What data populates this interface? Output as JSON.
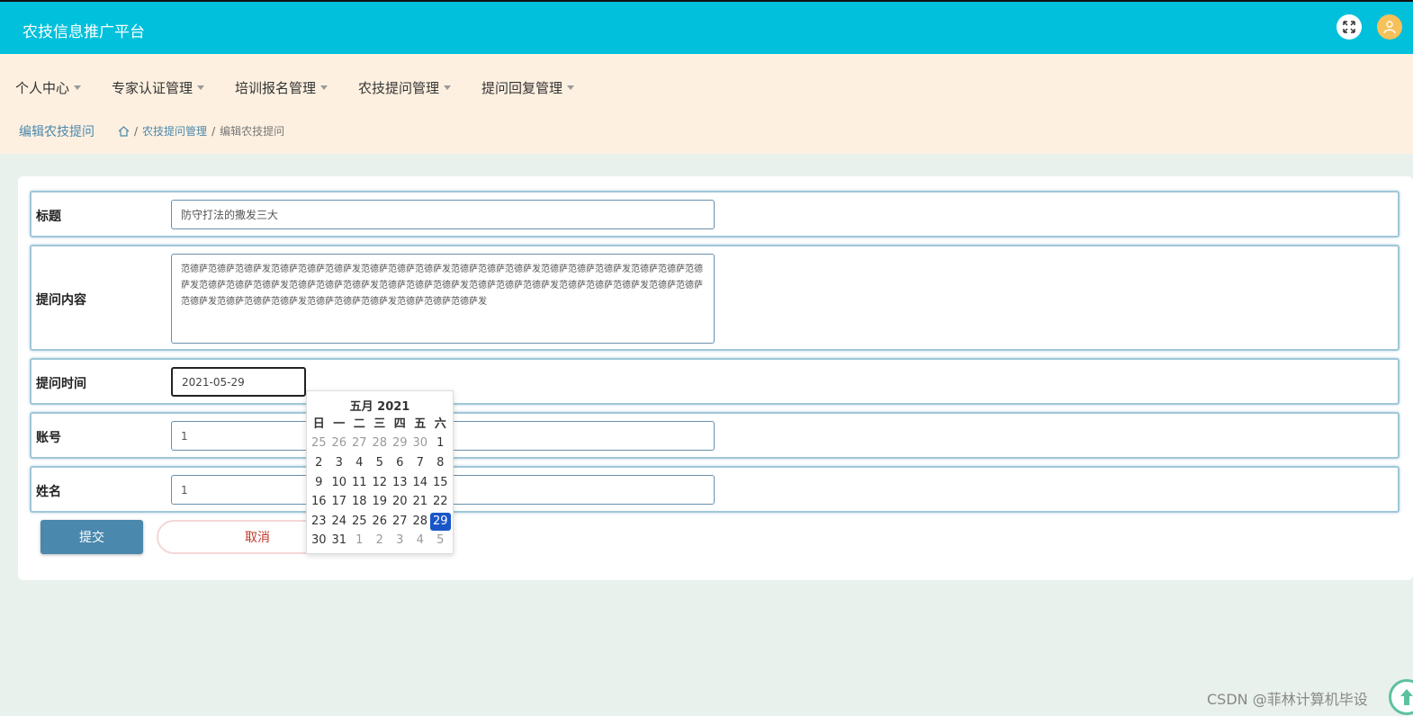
{
  "header": {
    "title": "农技信息推广平台",
    "fullscreen_icon": "fullscreen-icon",
    "avatar_icon": "user-avatar-icon"
  },
  "menu": {
    "items": [
      {
        "label": "个人中心"
      },
      {
        "label": "专家认证管理"
      },
      {
        "label": "培训报名管理"
      },
      {
        "label": "农技提问管理"
      },
      {
        "label": "提问回复管理"
      }
    ]
  },
  "breadcrumb": {
    "page_title": "编辑农技提问",
    "home_icon": "home-icon",
    "sep": "/",
    "parent": "农技提问管理",
    "current": "编辑农技提问"
  },
  "form": {
    "title_label": "标题",
    "title_value": "防守打法的撒发三大",
    "content_label": "提问内容",
    "content_value": "范德萨范德萨范德萨发范德萨范德萨范德萨发范德萨范德萨范德萨发范德萨范德萨范德萨发范德萨范德萨范德萨发范德萨范德萨范德萨发范德萨范德萨范德萨发范德萨范德萨范德萨发范德萨范德萨范德萨发范德萨范德萨范德萨发范德萨范德萨范德萨发范德萨范德萨范德萨发范德萨范德萨范德萨发范德萨范德萨范德萨发范德萨范德萨范德萨发",
    "time_label": "提问时间",
    "time_value": "2021-05-29",
    "account_label": "账号",
    "account_value": "1",
    "name_label": "姓名",
    "name_value": "1",
    "submit_label": "提交",
    "cancel_label": "取消"
  },
  "datepicker": {
    "header": "五月 2021",
    "weekdays": [
      "日",
      "一",
      "二",
      "三",
      "四",
      "五",
      "六"
    ],
    "weeks": [
      [
        {
          "d": "25",
          "m": 1
        },
        {
          "d": "26",
          "m": 1
        },
        {
          "d": "27",
          "m": 1
        },
        {
          "d": "28",
          "m": 1
        },
        {
          "d": "29",
          "m": 1
        },
        {
          "d": "30",
          "m": 1
        },
        {
          "d": "1",
          "m": 0
        }
      ],
      [
        {
          "d": "2",
          "m": 0
        },
        {
          "d": "3",
          "m": 0
        },
        {
          "d": "4",
          "m": 0
        },
        {
          "d": "5",
          "m": 0
        },
        {
          "d": "6",
          "m": 0
        },
        {
          "d": "7",
          "m": 0
        },
        {
          "d": "8",
          "m": 0
        }
      ],
      [
        {
          "d": "9",
          "m": 0
        },
        {
          "d": "10",
          "m": 0
        },
        {
          "d": "11",
          "m": 0
        },
        {
          "d": "12",
          "m": 0
        },
        {
          "d": "13",
          "m": 0
        },
        {
          "d": "14",
          "m": 0
        },
        {
          "d": "15",
          "m": 0
        }
      ],
      [
        {
          "d": "16",
          "m": 0
        },
        {
          "d": "17",
          "m": 0
        },
        {
          "d": "18",
          "m": 0
        },
        {
          "d": "19",
          "m": 0
        },
        {
          "d": "20",
          "m": 0
        },
        {
          "d": "21",
          "m": 0
        },
        {
          "d": "22",
          "m": 0
        }
      ],
      [
        {
          "d": "23",
          "m": 0
        },
        {
          "d": "24",
          "m": 0
        },
        {
          "d": "25",
          "m": 0
        },
        {
          "d": "26",
          "m": 0
        },
        {
          "d": "27",
          "m": 0
        },
        {
          "d": "28",
          "m": 0
        },
        {
          "d": "29",
          "m": 0,
          "sel": 1
        }
      ],
      [
        {
          "d": "30",
          "m": 0
        },
        {
          "d": "31",
          "m": 0
        },
        {
          "d": "1",
          "m": 1
        },
        {
          "d": "2",
          "m": 1
        },
        {
          "d": "3",
          "m": 1
        },
        {
          "d": "4",
          "m": 1
        },
        {
          "d": "5",
          "m": 1
        }
      ]
    ]
  },
  "watermark": "CSDN @菲林计算机毕设",
  "scroll_top_icon": "arrow-up-icon"
}
